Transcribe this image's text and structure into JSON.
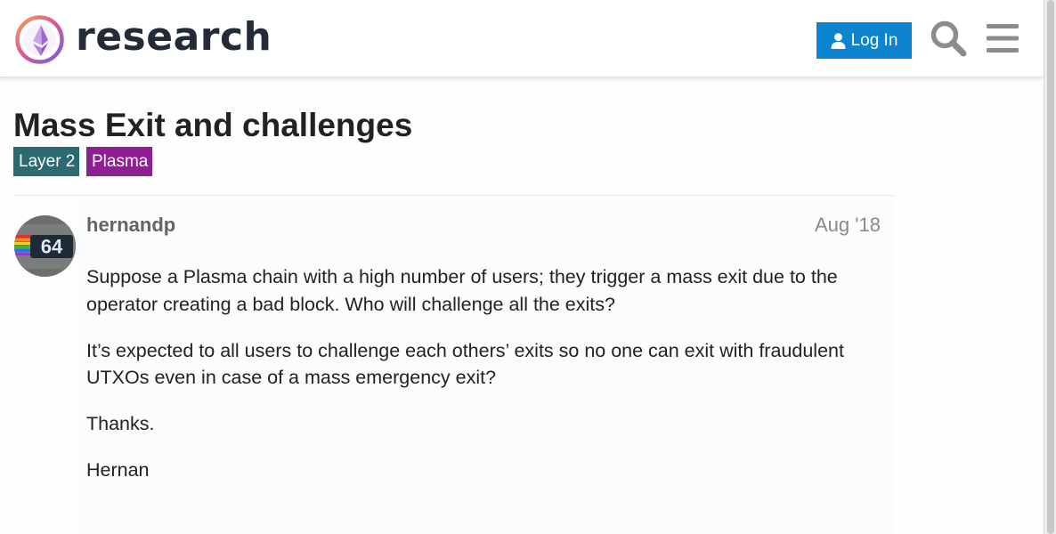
{
  "header": {
    "site_name": "research",
    "login_label": "Log In"
  },
  "topic": {
    "title": "Mass Exit and challenges",
    "tags": [
      {
        "label": "Layer 2",
        "color": "#2b6a70"
      },
      {
        "label": "Plasma",
        "color": "#8e1f92"
      }
    ]
  },
  "post": {
    "username": "hernandp",
    "avatar_text": "64",
    "date": "Aug '18",
    "paragraphs": [
      "Suppose a Plasma chain with a high number of users; they trigger a mass exit due to the operator creating a bad block. Who will challenge all the exits?",
      "It’s expected to all users to challenge each others’ exits so no one can exit with fraudulent UTXOs even in case of a mass emergency exit?",
      "Thanks.",
      "Hernan"
    ]
  },
  "icons": {
    "logo": "ethereum-research-logo-icon",
    "login": "user-icon",
    "search": "search-icon",
    "menu": "hamburger-menu-icon"
  },
  "colors": {
    "login_button": "#0d84d0",
    "title_text": "#222222",
    "username": "#646464"
  }
}
